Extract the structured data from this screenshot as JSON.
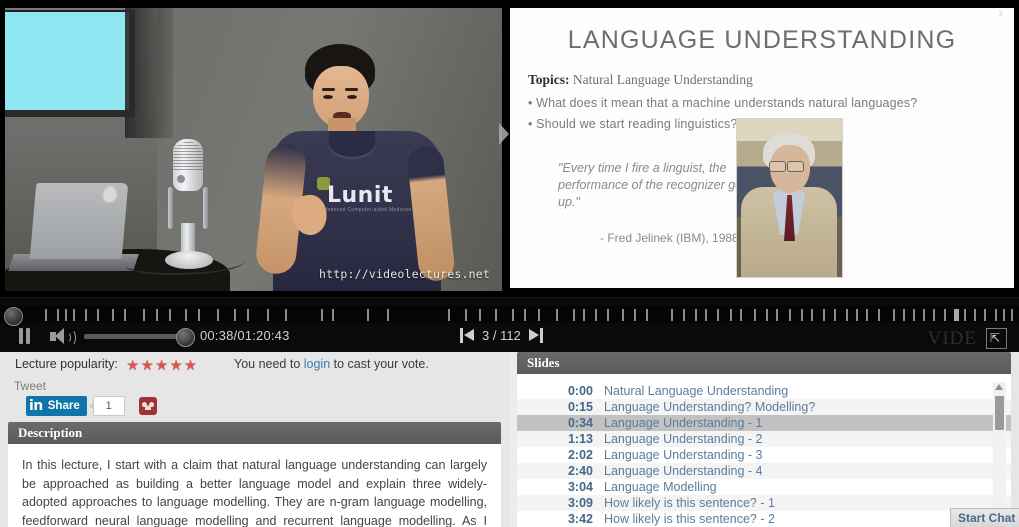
{
  "video": {
    "watermark": "http://videolectures.net",
    "speaker_shirt_logo": "Lunit",
    "speaker_shirt_tagline": "Advanced Computer-aided Medicine"
  },
  "slide": {
    "page_number": "3",
    "title": "LANGUAGE UNDERSTANDING",
    "topics_label": "Topics:",
    "topics_value": "Natural Language Understanding",
    "bullets": [
      "• What does it mean that a machine understands natural languages?",
      "• Should we start reading linguistics?"
    ],
    "quote": "\"Every time I fire a linguist, the performance of the recognizer goes up.\"",
    "quote_attribution": "- Fred Jelinek (IBM), 1988",
    "prev_slide_arrow": "prev-slide-arrow"
  },
  "player": {
    "pause_label": "Pause",
    "volume_label": "Volume",
    "time_display": "00:38/01:20:43",
    "current_time": "00:38",
    "total_time": "01:20:43",
    "page_count": "3 / 112",
    "current_page": 3,
    "total_pages": 112,
    "prev_label": "Previous slide",
    "next_label": "Next slide",
    "brand": "VIDE",
    "fullscreen_glyph": "⇱",
    "timeline_marks_percent": [
      4.4,
      5.6,
      6.4,
      7.2,
      8.3,
      9.5,
      11.0,
      12.2,
      14.0,
      15.3,
      16.6,
      18.2,
      19.4,
      21.3,
      23.0,
      24.2,
      26.2,
      28.0,
      31.5,
      32.6,
      36.0,
      38.0,
      44.0,
      45.6,
      47.0,
      48.6,
      50.2,
      51.4,
      52.8,
      54.6,
      56.2,
      57.2,
      58.4,
      59.6,
      61.0,
      62.2,
      63.4,
      65.8,
      67.0,
      68.2,
      69.2,
      70.4,
      71.6,
      72.6,
      74.0,
      75.2,
      76.2,
      77.4,
      78.6,
      79.6,
      80.8,
      81.8,
      83.0,
      84.0,
      85.0,
      86.2,
      87.6,
      88.6,
      89.6,
      90.6,
      91.6,
      92.6,
      93.6,
      94.6,
      95.6,
      96.6,
      97.6,
      98.4,
      99.2
    ]
  },
  "popularity": {
    "label": "Lecture popularity:",
    "stars": "★★★★★",
    "rating": 5,
    "vote_note_prefix": "You need to ",
    "vote_login_link": "login",
    "vote_note_suffix": " to cast your vote.",
    "vote_note_full": "You need to login to cast your vote."
  },
  "social": {
    "tweet_label": "Tweet",
    "linkedin_in": "in",
    "linkedin_share": "Share",
    "linkedin_count": "1",
    "mendeley_label": "mendeley-icon"
  },
  "description": {
    "header": "Description",
    "text": "In this lecture, I start with a claim that natural language understanding can largely be approached as building a better language model and explain three widely-adopted approaches to language modelling. They are n-gram language modelling, feedforward neural language modelling and recurrent language modelling. As I develop from the"
  },
  "slides_panel": {
    "header": "Slides",
    "active_index": 2,
    "rows": [
      {
        "time": "0:00",
        "title": "Natural Language Understanding"
      },
      {
        "time": "0:15",
        "title": "Language Understanding? Modelling?"
      },
      {
        "time": "0:34",
        "title": "Language Understanding - 1"
      },
      {
        "time": "1:13",
        "title": "Language Understanding - 2"
      },
      {
        "time": "2:02",
        "title": "Language Understanding - 3"
      },
      {
        "time": "2:40",
        "title": "Language Understanding - 4"
      },
      {
        "time": "3:04",
        "title": "Language Modelling"
      },
      {
        "time": "3:09",
        "title": "How likely is this sentence? - 1"
      },
      {
        "time": "3:42",
        "title": "How likely is this sentence? - 2"
      }
    ]
  },
  "chat": {
    "start_chat_label": "Start Chat"
  },
  "colors": {
    "panel_header": "#5f5f5f",
    "link": "#3a7fb5",
    "star": "#d9534f",
    "slide_link": "#5b7d9c",
    "active_row": "#c2c2c2",
    "linkedin": "#0e76a8",
    "page_bg": "#e6e6e6"
  }
}
